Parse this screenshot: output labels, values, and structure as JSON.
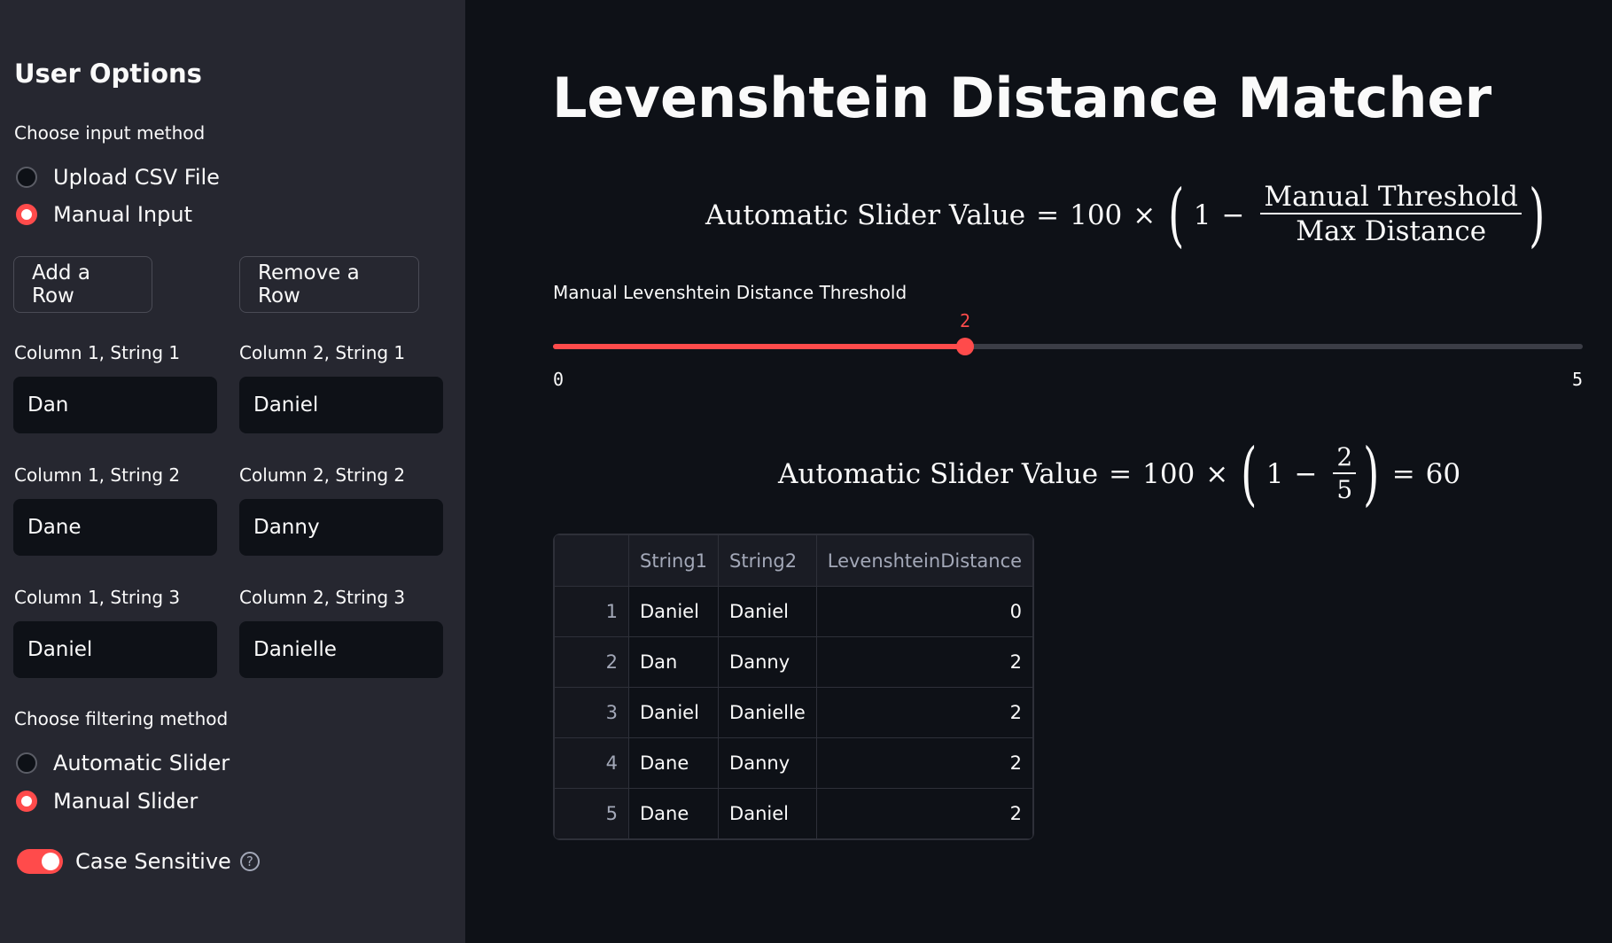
{
  "sidebar": {
    "title": "User Options",
    "input_method": {
      "label": "Choose input method",
      "options": [
        "Upload CSV File",
        "Manual Input"
      ],
      "selected": "Manual Input"
    },
    "buttons": {
      "add": "Add a Row",
      "remove": "Remove a Row"
    },
    "fields": [
      {
        "label": "Column 1, String 1",
        "value": "Dan"
      },
      {
        "label": "Column 2, String 1",
        "value": "Daniel"
      },
      {
        "label": "Column 1, String 2",
        "value": "Dane"
      },
      {
        "label": "Column 2, String 2",
        "value": "Danny"
      },
      {
        "label": "Column 1, String 3",
        "value": "Daniel"
      },
      {
        "label": "Column 2, String 3",
        "value": "Danielle"
      }
    ],
    "filter_method": {
      "label": "Choose filtering method",
      "options": [
        "Automatic Slider",
        "Manual Slider"
      ],
      "selected": "Manual Slider"
    },
    "toggle": {
      "label": "Case Sensitive",
      "on": true,
      "help_icon": "?"
    }
  },
  "main": {
    "title": "Levenshtein Distance Matcher",
    "formula1": {
      "lhs": "Automatic Slider Value",
      "eq": "=",
      "factor": "100",
      "times": "×",
      "one": "1",
      "minus": "−",
      "numerator": "Manual Threshold",
      "denominator": "Max Distance"
    },
    "slider": {
      "label": "Manual Levenshtein Distance Threshold",
      "min_label": "0",
      "max_label": "5",
      "value_label": "2",
      "value_fraction": 0.4,
      "accent": "#ff4b4b"
    },
    "formula2": {
      "lhs": "Automatic Slider Value",
      "eq": "=",
      "factor": "100",
      "times": "×",
      "one": "1",
      "minus": "−",
      "numerator": "2",
      "denominator": "5",
      "eq2": "=",
      "result": "60"
    },
    "table": {
      "columns": [
        "",
        "String1",
        "String2",
        "LevenshteinDistance"
      ],
      "rows": [
        [
          "1",
          "Daniel",
          "Daniel",
          "0"
        ],
        [
          "2",
          "Dan",
          "Danny",
          "2"
        ],
        [
          "3",
          "Daniel",
          "Danielle",
          "2"
        ],
        [
          "4",
          "Dane",
          "Danny",
          "2"
        ],
        [
          "5",
          "Dane",
          "Daniel",
          "2"
        ]
      ]
    }
  }
}
